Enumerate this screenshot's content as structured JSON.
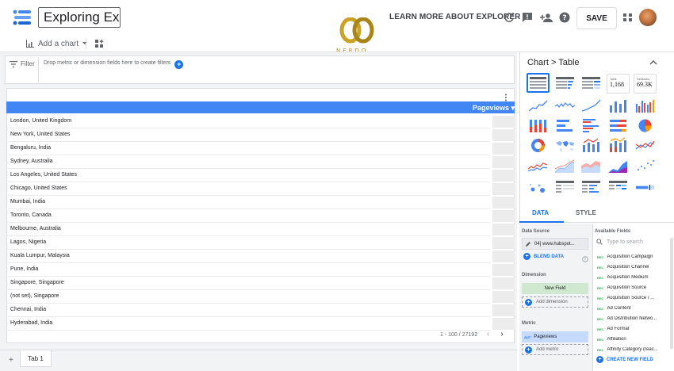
{
  "header": {
    "report_title": "Exploring Explorer",
    "learn_more": "LEARN MORE ABOUT EXPLORER",
    "save_label": "SAVE",
    "watermark_text": "NERDO"
  },
  "toolbar": {
    "add_chart_label": "Add a chart"
  },
  "filter": {
    "label": "Filter",
    "drop_hint": "Drop metric or dimension fields here to create filters"
  },
  "table": {
    "column_header": "Pageviews",
    "rows": [
      "London, United Kingdom",
      "New York, United States",
      "Bengaluru, India",
      "Sydney, Australia",
      "Los Angeles, United States",
      "Chicago, United States",
      "Mumbai, India",
      "Toronto, Canada",
      "Melbourne, Australia",
      "Lagos, Nigeria",
      "Kuala Lumpur, Malaysia",
      "Pune, India",
      "Singapore, Singapore",
      "(not set), Singapore",
      "Chennai, India",
      "Hyderabad, India"
    ],
    "pagination": "1 - 100 / 27192"
  },
  "tabs": {
    "add_label": "+",
    "page_tab": "Tab 1"
  },
  "panel": {
    "breadcrumb": "Chart > Table",
    "scorecard_total_label": "Total",
    "scorecard_total_value": "1,168",
    "scorecard_sessions_label": "Sessions",
    "scorecard_sessions_value": "69.3K",
    "tab_data": "DATA",
    "tab_style": "STYLE",
    "data_source_label": "Data Source",
    "data_source_value": "04] www.hubspot...",
    "blend_label": "BLEND DATA",
    "dimension_label": "Dimension",
    "dimension_value": "New Field",
    "add_dimension": "Add dimension",
    "metric_label": "Metric",
    "metric_type": "AUT",
    "metric_value": "Pageviews",
    "add_metric": "Add metric",
    "available_label": "Available Fields",
    "search_placeholder": "Type to search",
    "field_type": "REC",
    "fields": [
      "Acquisition Campaign",
      "Acquisition Channel",
      "Acquisition Medium",
      "Acquisition Source",
      "Acquisition Source / ...",
      "Ad Content",
      "Ad Distribution Netwo...",
      "Ad Format",
      "Affiliation",
      "Affinity Category (reac..."
    ],
    "create_field": "CREATE NEW FIELD"
  },
  "colors": {
    "accent": "#1a73e8",
    "table_header": "#4285f4",
    "dimension_chip": "#cfe8cf",
    "metric_chip": "#c6dafc"
  }
}
